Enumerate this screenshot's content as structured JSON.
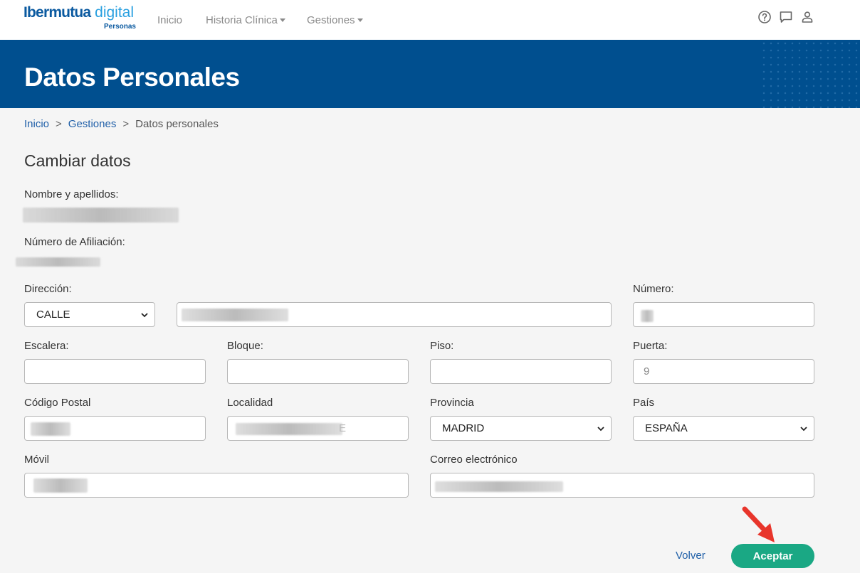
{
  "brand": {
    "name_a": "Ibermutua",
    "name_b": " digital",
    "sub": "Personas"
  },
  "nav": {
    "inicio": "Inicio",
    "historia": "Historia Clínica",
    "gestiones": "Gestiones"
  },
  "header_icons": [
    "help-circle-icon",
    "chat-icon",
    "user-icon"
  ],
  "hero": {
    "title": "Datos Personales"
  },
  "breadcrumb": {
    "home": "Inicio",
    "section": "Gestiones",
    "current": "Datos personales",
    "separator": ">"
  },
  "form": {
    "title": "Cambiar datos",
    "nombre_label": "Nombre y apellidos:",
    "afiliacion_label": "Número de Afiliación:",
    "direccion_label": "Dirección:",
    "via_tipo_value": "CALLE",
    "numero_label": "Número:",
    "escalera_label": "Escalera:",
    "bloque_label": "Bloque:",
    "piso_label": "Piso:",
    "puerta_label": "Puerta:",
    "puerta_value": "9",
    "cp_label": "Código Postal",
    "localidad_label": "Localidad",
    "localidad_suffix": "E",
    "provincia_label": "Provincia",
    "provincia_value": "MADRID",
    "pais_label": "País",
    "pais_value": "ESPAÑA",
    "movil_label": "Móvil",
    "correo_label": "Correo electrónico"
  },
  "actions": {
    "volver": "Volver",
    "aceptar": "Aceptar"
  },
  "colors": {
    "hero_bg": "#004f8f",
    "accept_bg": "#1aa884",
    "link": "#1f5fa8",
    "arrow": "#e8352b"
  }
}
